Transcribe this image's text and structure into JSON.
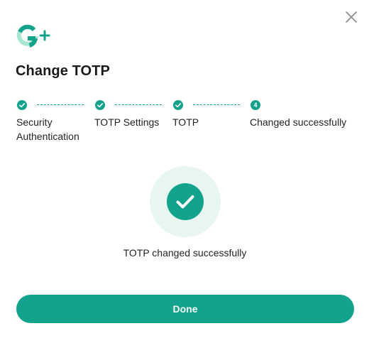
{
  "dialog": {
    "title": "Change TOTP",
    "close_icon": "close-icon",
    "logo_icon": "g-plus-logo"
  },
  "steps": [
    {
      "label": "Security Authentication",
      "status": "completed",
      "icon": "check-icon"
    },
    {
      "label": "TOTP Settings",
      "status": "completed",
      "icon": "check-icon"
    },
    {
      "label": "TOTP",
      "status": "completed",
      "icon": "check-icon"
    },
    {
      "label": "Changed successfully",
      "status": "current",
      "number": "4"
    }
  ],
  "result": {
    "icon": "success-check-icon",
    "message": "TOTP changed successfully"
  },
  "actions": {
    "done_label": "Done"
  },
  "colors": {
    "accent": "#13a38c",
    "accent_light": "#e8f6f2",
    "logo_light": "#a8e6d4"
  }
}
